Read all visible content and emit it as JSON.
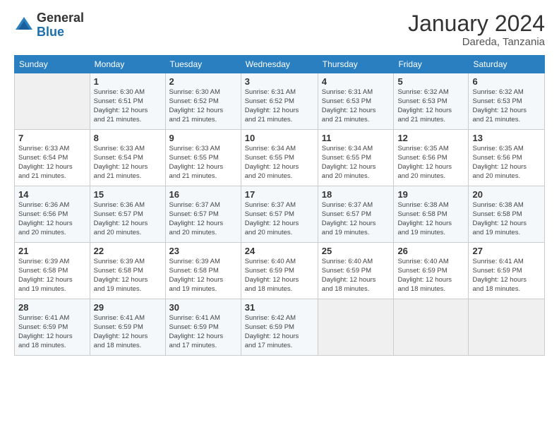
{
  "logo": {
    "general": "General",
    "blue": "Blue"
  },
  "title": "January 2024",
  "location": "Dareda, Tanzania",
  "days_of_week": [
    "Sunday",
    "Monday",
    "Tuesday",
    "Wednesday",
    "Thursday",
    "Friday",
    "Saturday"
  ],
  "weeks": [
    [
      {
        "day": "",
        "info": ""
      },
      {
        "day": "1",
        "info": "Sunrise: 6:30 AM\nSunset: 6:51 PM\nDaylight: 12 hours\nand 21 minutes."
      },
      {
        "day": "2",
        "info": "Sunrise: 6:30 AM\nSunset: 6:52 PM\nDaylight: 12 hours\nand 21 minutes."
      },
      {
        "day": "3",
        "info": "Sunrise: 6:31 AM\nSunset: 6:52 PM\nDaylight: 12 hours\nand 21 minutes."
      },
      {
        "day": "4",
        "info": "Sunrise: 6:31 AM\nSunset: 6:53 PM\nDaylight: 12 hours\nand 21 minutes."
      },
      {
        "day": "5",
        "info": "Sunrise: 6:32 AM\nSunset: 6:53 PM\nDaylight: 12 hours\nand 21 minutes."
      },
      {
        "day": "6",
        "info": "Sunrise: 6:32 AM\nSunset: 6:53 PM\nDaylight: 12 hours\nand 21 minutes."
      }
    ],
    [
      {
        "day": "7",
        "info": "Sunrise: 6:33 AM\nSunset: 6:54 PM\nDaylight: 12 hours\nand 21 minutes."
      },
      {
        "day": "8",
        "info": "Sunrise: 6:33 AM\nSunset: 6:54 PM\nDaylight: 12 hours\nand 21 minutes."
      },
      {
        "day": "9",
        "info": "Sunrise: 6:33 AM\nSunset: 6:55 PM\nDaylight: 12 hours\nand 21 minutes."
      },
      {
        "day": "10",
        "info": "Sunrise: 6:34 AM\nSunset: 6:55 PM\nDaylight: 12 hours\nand 20 minutes."
      },
      {
        "day": "11",
        "info": "Sunrise: 6:34 AM\nSunset: 6:55 PM\nDaylight: 12 hours\nand 20 minutes."
      },
      {
        "day": "12",
        "info": "Sunrise: 6:35 AM\nSunset: 6:56 PM\nDaylight: 12 hours\nand 20 minutes."
      },
      {
        "day": "13",
        "info": "Sunrise: 6:35 AM\nSunset: 6:56 PM\nDaylight: 12 hours\nand 20 minutes."
      }
    ],
    [
      {
        "day": "14",
        "info": "Sunrise: 6:36 AM\nSunset: 6:56 PM\nDaylight: 12 hours\nand 20 minutes."
      },
      {
        "day": "15",
        "info": "Sunrise: 6:36 AM\nSunset: 6:57 PM\nDaylight: 12 hours\nand 20 minutes."
      },
      {
        "day": "16",
        "info": "Sunrise: 6:37 AM\nSunset: 6:57 PM\nDaylight: 12 hours\nand 20 minutes."
      },
      {
        "day": "17",
        "info": "Sunrise: 6:37 AM\nSunset: 6:57 PM\nDaylight: 12 hours\nand 20 minutes."
      },
      {
        "day": "18",
        "info": "Sunrise: 6:37 AM\nSunset: 6:57 PM\nDaylight: 12 hours\nand 19 minutes."
      },
      {
        "day": "19",
        "info": "Sunrise: 6:38 AM\nSunset: 6:58 PM\nDaylight: 12 hours\nand 19 minutes."
      },
      {
        "day": "20",
        "info": "Sunrise: 6:38 AM\nSunset: 6:58 PM\nDaylight: 12 hours\nand 19 minutes."
      }
    ],
    [
      {
        "day": "21",
        "info": "Sunrise: 6:39 AM\nSunset: 6:58 PM\nDaylight: 12 hours\nand 19 minutes."
      },
      {
        "day": "22",
        "info": "Sunrise: 6:39 AM\nSunset: 6:58 PM\nDaylight: 12 hours\nand 19 minutes."
      },
      {
        "day": "23",
        "info": "Sunrise: 6:39 AM\nSunset: 6:58 PM\nDaylight: 12 hours\nand 19 minutes."
      },
      {
        "day": "24",
        "info": "Sunrise: 6:40 AM\nSunset: 6:59 PM\nDaylight: 12 hours\nand 18 minutes."
      },
      {
        "day": "25",
        "info": "Sunrise: 6:40 AM\nSunset: 6:59 PM\nDaylight: 12 hours\nand 18 minutes."
      },
      {
        "day": "26",
        "info": "Sunrise: 6:40 AM\nSunset: 6:59 PM\nDaylight: 12 hours\nand 18 minutes."
      },
      {
        "day": "27",
        "info": "Sunrise: 6:41 AM\nSunset: 6:59 PM\nDaylight: 12 hours\nand 18 minutes."
      }
    ],
    [
      {
        "day": "28",
        "info": "Sunrise: 6:41 AM\nSunset: 6:59 PM\nDaylight: 12 hours\nand 18 minutes."
      },
      {
        "day": "29",
        "info": "Sunrise: 6:41 AM\nSunset: 6:59 PM\nDaylight: 12 hours\nand 18 minutes."
      },
      {
        "day": "30",
        "info": "Sunrise: 6:41 AM\nSunset: 6:59 PM\nDaylight: 12 hours\nand 17 minutes."
      },
      {
        "day": "31",
        "info": "Sunrise: 6:42 AM\nSunset: 6:59 PM\nDaylight: 12 hours\nand 17 minutes."
      },
      {
        "day": "",
        "info": ""
      },
      {
        "day": "",
        "info": ""
      },
      {
        "day": "",
        "info": ""
      }
    ]
  ]
}
